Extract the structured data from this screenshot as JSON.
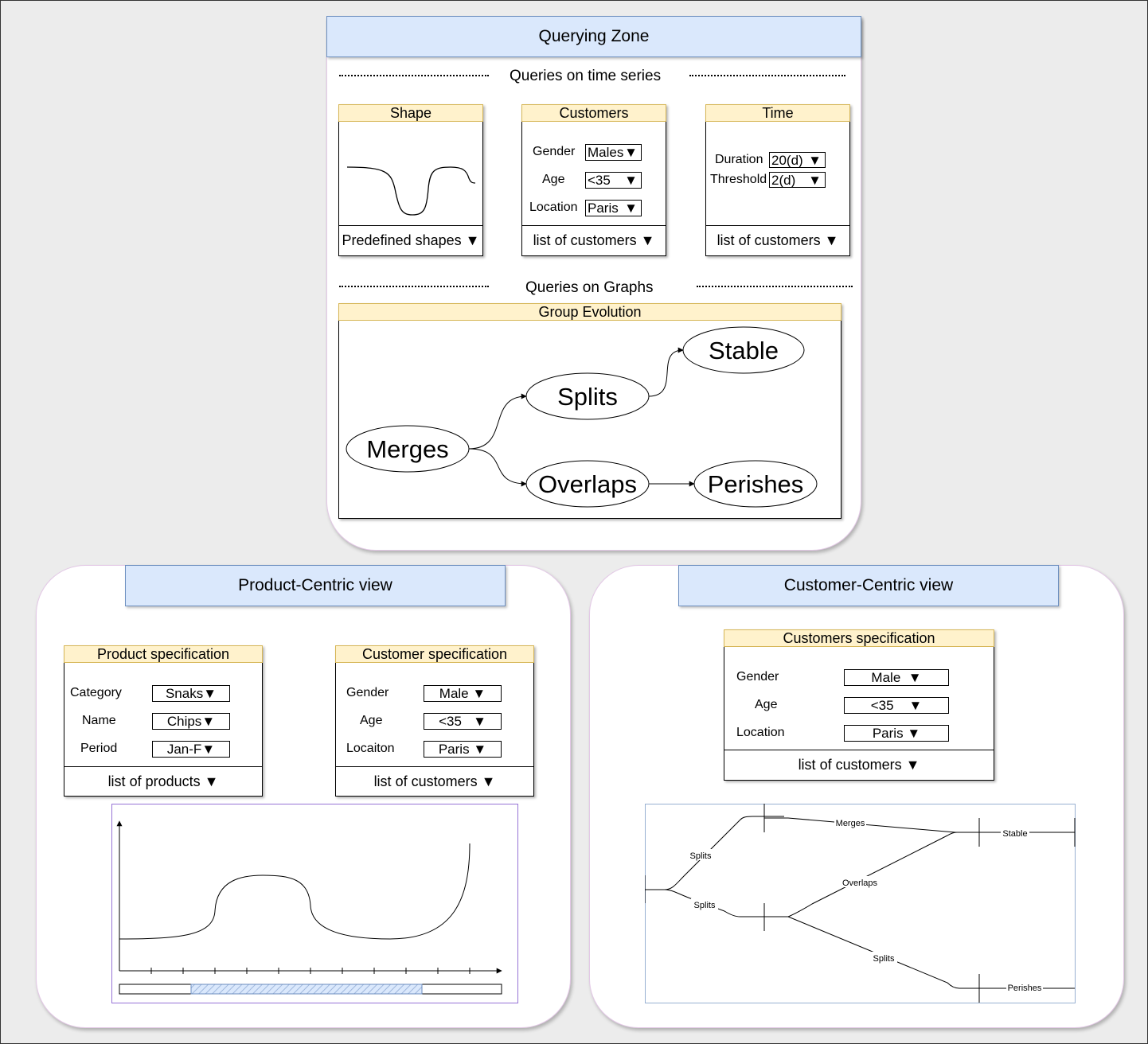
{
  "querying_zone": {
    "title": "Querying Zone",
    "ts_section": "Queries on time series",
    "graph_section": "Queries on Graphs",
    "shape_panel": {
      "title": "Shape",
      "footer": "Predefined shapes ▼"
    },
    "customers_panel": {
      "title": "Customers",
      "gender_label": "Gender",
      "gender_value": "Males",
      "age_label": "Age",
      "age_value": "<35",
      "location_label": "Location",
      "location_value": "Paris",
      "footer": "list of customers ▼"
    },
    "time_panel": {
      "title": "Time",
      "duration_label": "Duration",
      "duration_value": "20(d)",
      "threshold_label": "Threshold",
      "threshold_value": "2(d)",
      "footer": "list of customers ▼"
    },
    "group_evolution": {
      "title": "Group Evolution",
      "nodes": {
        "merges": "Merges",
        "splits": "Splits",
        "stable": "Stable",
        "overlaps": "Overlaps",
        "perishes": "Perishes"
      }
    }
  },
  "product_view": {
    "title": "Product-Centric view",
    "product_spec": {
      "title": "Product specification",
      "category_label": "Category",
      "category_value": "Snaks",
      "name_label": "Name",
      "name_value": "Chips",
      "period_label": "Period",
      "period_value": "Jan-F",
      "footer": "list of products ▼"
    },
    "customer_spec": {
      "title": "Customer specification",
      "gender_label": "Gender",
      "gender_value": "Male",
      "age_label": "Age",
      "age_value": "<35",
      "location_label": "Locaiton",
      "location_value": "Paris",
      "footer": "list of customers ▼"
    }
  },
  "customer_view": {
    "title": "Customer-Centric view",
    "spec": {
      "title": "Customers specification",
      "gender_label": "Gender",
      "gender_value": "Male",
      "age_label": "Age",
      "age_value": "<35",
      "location_label": "Location",
      "location_value": "Paris",
      "footer": "list of customers ▼"
    },
    "timeline_labels": {
      "splits_top": "Splits",
      "splits_bottom": "Splits",
      "merges": "Merges",
      "overlaps": "Overlaps",
      "splits_lower": "Splits",
      "stable": "Stable",
      "perishes": "Perishes"
    }
  },
  "dropdown_arrow": "▼",
  "colors": {
    "title_fill": "#dae8fc",
    "header_fill": "#fff2cc",
    "zone_border": "#e3c8e6",
    "background": "#ececec"
  }
}
